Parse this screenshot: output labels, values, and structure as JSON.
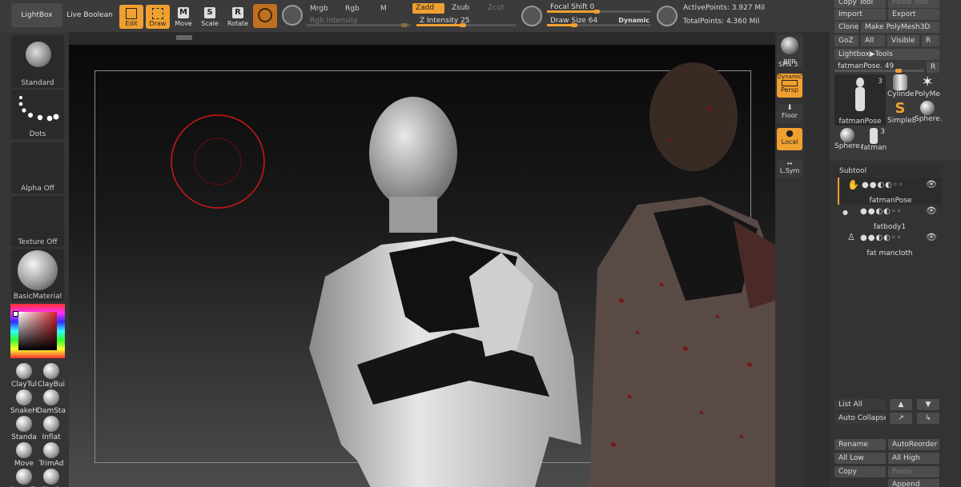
{
  "colors": {
    "accent": "#f0a030",
    "brush_ring": "#d01818"
  },
  "topbar": {
    "lightbox": "LightBox",
    "live_boolean": "Live Boolean",
    "edit": "Edit",
    "draw": "Draw",
    "move": "Move",
    "scale": "Scale",
    "rotate": "Rotate",
    "mrgb": "Mrgb",
    "rgb": "Rgb",
    "m": "M",
    "rgb_intensity": "Rgb Intensity",
    "zadd": "Zadd",
    "zsub": "Zsub",
    "zcut": "Zcut",
    "z_intensity_label": "Z Intensity",
    "z_intensity_value": "25",
    "focal_shift_label": "Focal Shift",
    "focal_shift_value": "0",
    "draw_size_label": "Draw Size",
    "draw_size_value": "64",
    "dynamic": "Dynamic",
    "active_points": "ActivePoints: 3.927 Mil",
    "total_points": "TotalPoints: 4.360 Mil"
  },
  "leftshelf": {
    "standard": "Standard",
    "dots": "Dots",
    "alpha_off": "Alpha Off",
    "texture_off": "Texture Off",
    "basic_material": "BasicMaterial",
    "brushes": [
      "ClayTul",
      "ClayBui",
      "SnakeH",
      "DamSta",
      "Standa",
      "Inflat",
      "Move",
      "TrimAd",
      "CurveTu",
      "Pinch"
    ]
  },
  "rightstrip": {
    "bpr": "BPR",
    "spix_label": "SPix",
    "spix_value": "3",
    "dynamic": "Dynamic",
    "persp": "Persp",
    "floor": "Floor",
    "local": "Local",
    "lsym": "L.Sym"
  },
  "rightpanel": {
    "copy_tool": "Copy Tool",
    "paste_tool": "Paste Tool",
    "import": "Import",
    "export": "Export",
    "clone": "Clone",
    "make_polymesh": "Make PolyMesh3D",
    "goz": "GoZ",
    "all": "All",
    "visible": "Visible",
    "lightbox_tools": "Lightbox▶Tools",
    "tool_slider_label": "fatmanPose.",
    "tool_slider_value": "49",
    "r": "R",
    "tools": [
      {
        "label": "fatmanPose",
        "count": "3"
      },
      {
        "label": "Cylinde"
      },
      {
        "label": "PolyMe"
      },
      {
        "label": "SimpleE"
      },
      {
        "label": "Sphere."
      },
      {
        "label": "Sphere."
      },
      {
        "label": "fatman",
        "count": "3"
      }
    ],
    "subtool": {
      "title": "Subtool",
      "items": [
        "fatmanPose",
        "fatbody1",
        "fat mancloth"
      ]
    },
    "list_all": "List All",
    "auto_collapse": "Auto Collapse",
    "rename": "Rename",
    "auto_reorder": "AutoReorder",
    "all_low": "All Low",
    "all_high": "All High",
    "copy": "Copy",
    "paste": "Paste",
    "append": "Append"
  }
}
